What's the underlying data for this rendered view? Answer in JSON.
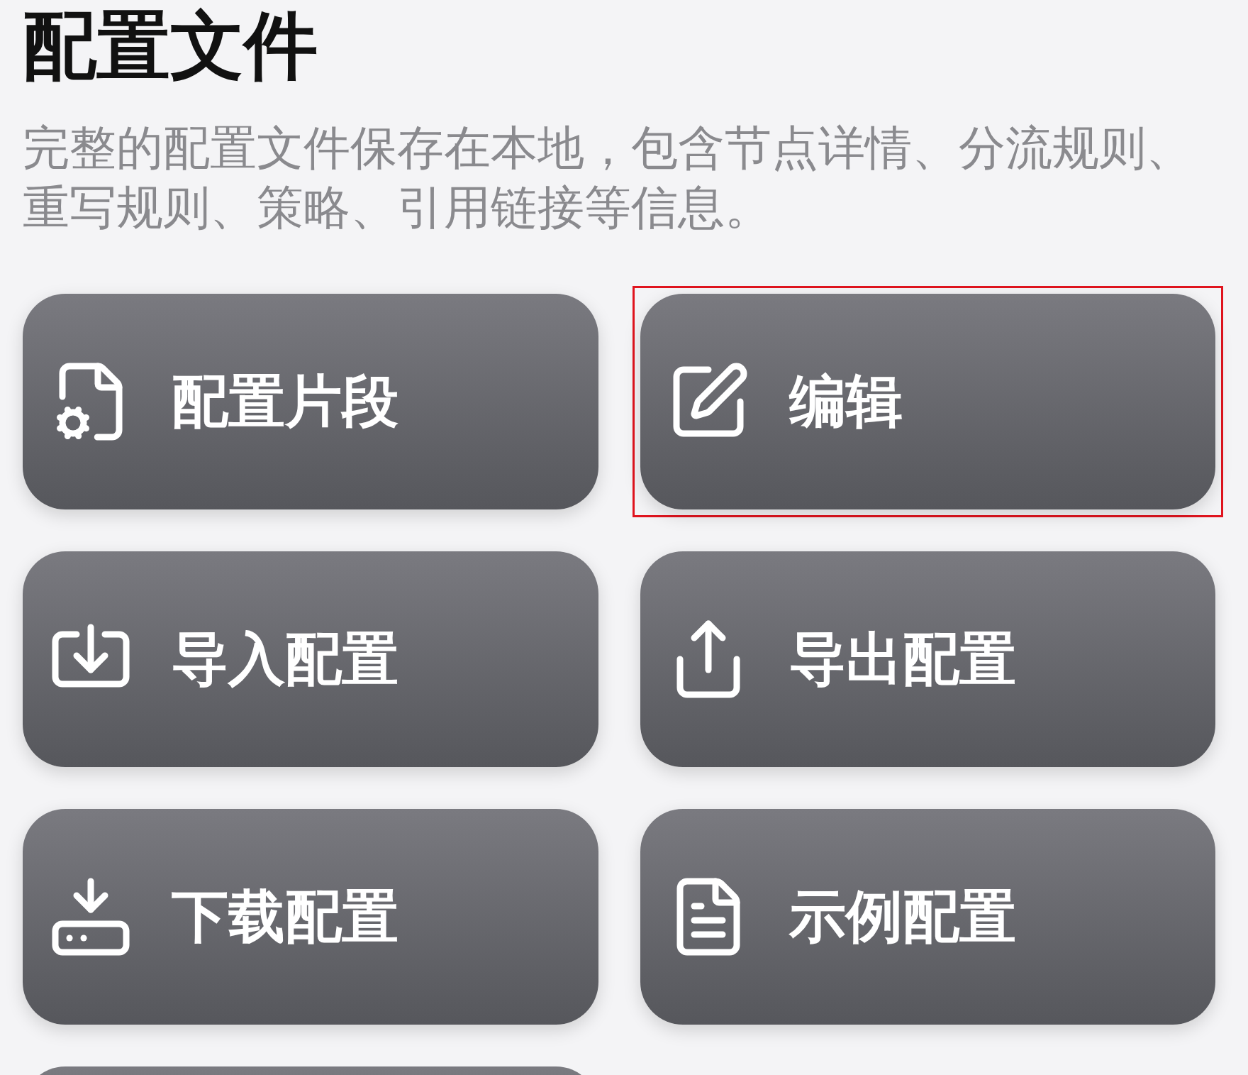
{
  "title": "配置文件",
  "description": "完整的配置文件保存在本地，包含节点详情、分流规则、重写规则、策略、引用链接等信息。",
  "buttons": [
    {
      "label": "配置片段",
      "selected": false
    },
    {
      "label": "编辑",
      "selected": true
    },
    {
      "label": "导入配置",
      "selected": false
    },
    {
      "label": "导出配置",
      "selected": false
    },
    {
      "label": "下载配置",
      "selected": false
    },
    {
      "label": "示例配置",
      "selected": false
    }
  ]
}
